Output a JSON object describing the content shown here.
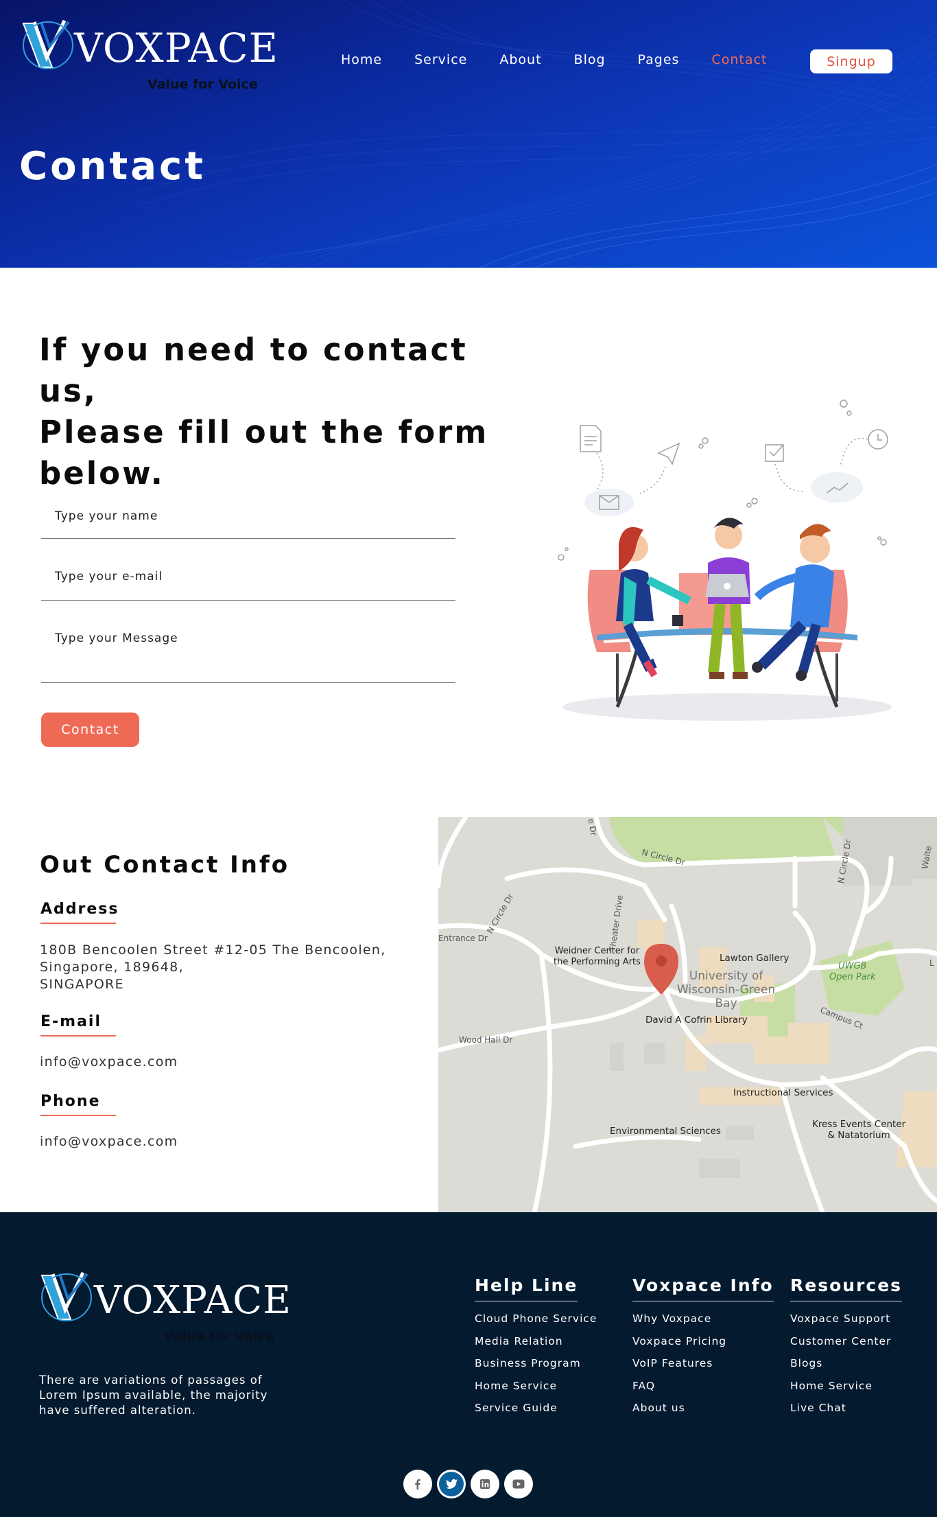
{
  "brand": {
    "name": "VOXPACE",
    "tagline": "Value for Voice"
  },
  "nav": {
    "items": [
      "Home",
      "Service",
      "About",
      "Blog",
      "Pages",
      "Contact"
    ],
    "active": "Contact",
    "signup_label": "Singup"
  },
  "hero": {
    "title": "Contact"
  },
  "form": {
    "heading_lines": [
      "If you need to contact us,",
      "Please fill out the form",
      "below."
    ],
    "name_placeholder": "Type your name",
    "email_placeholder": "Type your e-mail",
    "message_placeholder": "Type your Message",
    "submit_label": "Contact"
  },
  "contact_info": {
    "title": "Out Contact Info",
    "address_label": "Address",
    "address_lines": [
      "180B Bencoolen Street #12-05 The Bencoolen,",
      "Singapore, 189648,",
      "SINGAPORE"
    ],
    "email_label": "E-mail",
    "email_value": "info@voxpace.com",
    "phone_label": "Phone",
    "phone_value": "info@voxpace.com"
  },
  "map": {
    "labels": {
      "n_circle_dr_top": "N Circle Dr",
      "n_circle_dr_left": "N Circle Dr",
      "n_circle_dr_right": "N Circle Dr",
      "walter": "Walte",
      "theater_drive": "Theater Drive",
      "entrance_dr": "Entrance Dr",
      "weidner": "Weidner Center for\nthe Performing Arts",
      "lawton": "Lawton Gallery",
      "university": "University of\nWisconsin-Green\nBay",
      "library": "David A Cofrin Library",
      "campus_ct": "Campus Ct",
      "park": "UWGB\nOpen Park",
      "wood_hall": "Wood Hall Dr",
      "instructional": "Instructional Services",
      "environmental": "Environmental Sciences",
      "kress": "Kress Events Center\n& Natatorium",
      "edge_l": "L",
      "edge_e": "e Dr"
    },
    "colors": {
      "base": "#dcdbd5",
      "road": "#ffffff",
      "green": "#c6dea3",
      "building": "#eedcc0",
      "pin": "#d95d4c"
    }
  },
  "footer": {
    "about": "There are variations of passages of Lorem Ipsum available, the majority have suffered alteration.",
    "columns": [
      {
        "title": "Help Line",
        "links": [
          "Cloud Phone Service",
          "Media Relation",
          "Business Program",
          "Home Service",
          "Service Guide"
        ]
      },
      {
        "title": "Voxpace Info",
        "links": [
          "Why Voxpace",
          "Voxpace Pricing",
          "VoIP Features",
          "FAQ",
          "About us"
        ]
      },
      {
        "title": "Resources",
        "links": [
          "Voxpace Support",
          "Customer Center",
          "Blogs",
          "Home Service",
          "Live Chat"
        ]
      }
    ],
    "social": [
      "facebook-icon",
      "twitter-icon",
      "linkedin-icon",
      "youtube-icon"
    ]
  },
  "colors": {
    "accent": "#ef6a55",
    "hero_dark": "#071466",
    "hero_light": "#0b52d8",
    "footer_bg": "#041a2f"
  }
}
